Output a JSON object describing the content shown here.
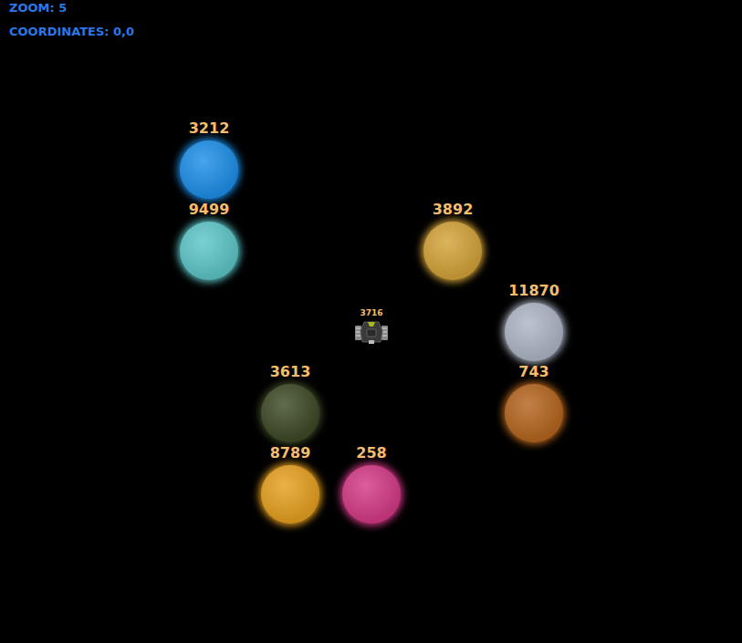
{
  "hud": {
    "zoom": "ZOOM: 5",
    "coordinates": "COORDINATES: 0,0"
  },
  "ship": {
    "label": "3716"
  },
  "planets": [
    {
      "label": "3212",
      "color": "#1e8fe8"
    },
    {
      "label": "9499",
      "color": "#5ec6c8"
    },
    {
      "label": "3892",
      "color": "#d4a33a"
    },
    {
      "label": "11870",
      "color": "#aeb6c6"
    },
    {
      "label": "3613",
      "color": "#3e4a26"
    },
    {
      "label": "743",
      "color": "#b5651e"
    },
    {
      "label": "8789",
      "color": "#e6a020"
    },
    {
      "label": "258",
      "color": "#d33a86"
    }
  ]
}
